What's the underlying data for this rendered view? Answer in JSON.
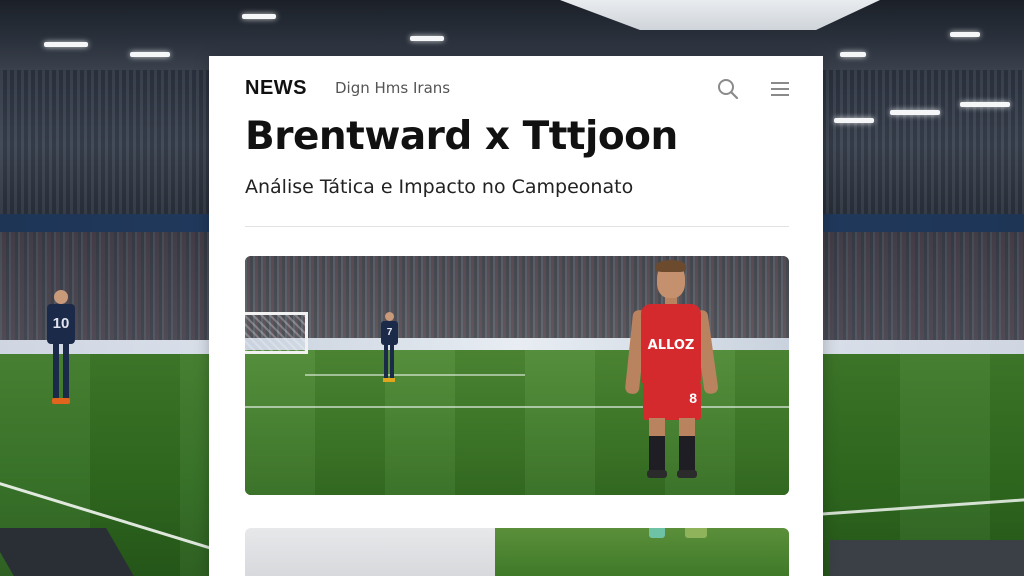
{
  "header": {
    "brand": "NEWS",
    "nav_text": "Dign Hms Irans"
  },
  "article": {
    "headline": "Brentward x Tttjoon",
    "subheadline": "Análise Tática e Impacto no Campeonato"
  },
  "hero_image": {
    "main_player_shirt_text": "ALLOZ",
    "main_player_shorts_number": "8",
    "background_player_number": "7"
  },
  "background": {
    "player_number": "10"
  },
  "icons": {
    "search": "search-icon",
    "menu": "menu-icon"
  },
  "colors": {
    "card_bg": "#ffffff",
    "text": "#111111",
    "kit_red": "#d42a2e",
    "kit_navy": "#1c2a4a",
    "pitch": "#3f7a29"
  }
}
